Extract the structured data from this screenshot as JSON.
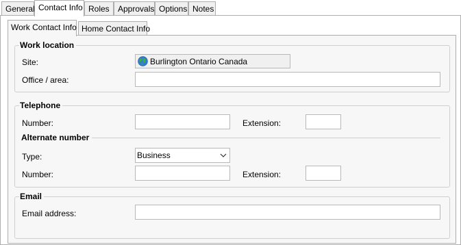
{
  "outer_tabs": [
    {
      "label": "General",
      "active": false
    },
    {
      "label": "Contact Info",
      "active": true
    },
    {
      "label": "Roles",
      "active": false
    },
    {
      "label": "Approvals",
      "active": false
    },
    {
      "label": "Options",
      "active": false
    },
    {
      "label": "Notes",
      "active": false
    }
  ],
  "inner_tabs": [
    {
      "label": "Work Contact Info",
      "active": true
    },
    {
      "label": "Home Contact Info",
      "active": false
    }
  ],
  "work_location": {
    "title": "Work location",
    "site_label": "Site:",
    "site_value": "Burlington Ontario Canada",
    "site_icon": "globe-icon",
    "office_label": "Office / area:",
    "office_value": ""
  },
  "telephone": {
    "title": "Telephone",
    "number_label": "Number:",
    "number_value": "",
    "extension_label": "Extension:",
    "extension_value": "",
    "alternate": {
      "title": "Alternate number",
      "type_label": "Type:",
      "type_value": "Business",
      "number_label": "Number:",
      "number_value": "",
      "extension_label": "Extension:",
      "extension_value": ""
    }
  },
  "email": {
    "title": "Email",
    "address_label": "Email address:",
    "address_value": ""
  }
}
